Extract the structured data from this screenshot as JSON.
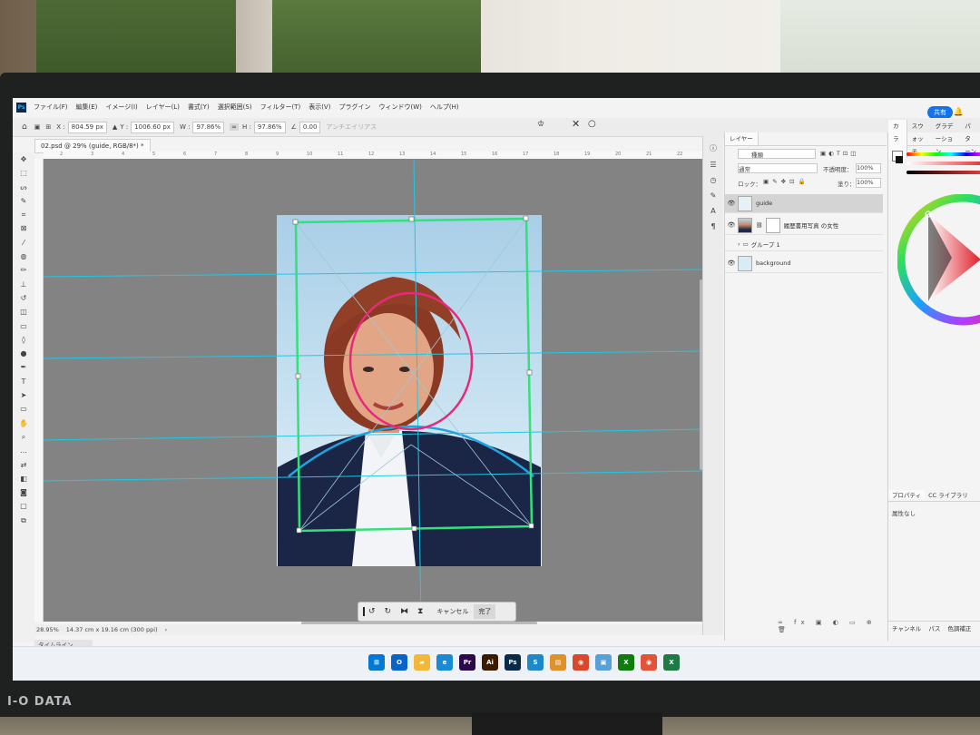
{
  "app": {
    "logo": "Ps",
    "menu": [
      "ファイル(F)",
      "編集(E)",
      "イメージ(I)",
      "レイヤー(L)",
      "書式(Y)",
      "選択範囲(S)",
      "フィルター(T)",
      "表示(V)",
      "プラグイン",
      "ウィンドウ(W)",
      "ヘルプ(H)"
    ],
    "share_label": "共有"
  },
  "options": {
    "x_label": "X :",
    "x_value": "804.59 px",
    "y_label": "Y :",
    "y_value": "1006.60 px",
    "w_label": "W :",
    "w_value": "97.86%",
    "h_label": "H :",
    "h_value": "97.86%",
    "angle_value": "0.00",
    "antialias_label": "アンチエイリアス"
  },
  "document": {
    "tab_title": "02.psd @ 29% (guide, RGB/8*) *",
    "zoom": "28.95%",
    "size_info": "14.37 cm x 19.16 cm (300 ppi)",
    "timeline_label": "タイムライン"
  },
  "ruler": {
    "ticks": [
      "2",
      "3",
      "4",
      "5",
      "6",
      "7",
      "8",
      "9",
      "10",
      "11",
      "12",
      "13",
      "14",
      "15",
      "16",
      "17",
      "18",
      "19",
      "20",
      "21",
      "22"
    ]
  },
  "context_bar": {
    "cancel_label": "キャンセル",
    "done_label": "完了"
  },
  "layers_panel": {
    "tab_label": "レイヤー",
    "kind_label": "種類",
    "blend_mode": "通常",
    "opacity_label": "不透明度：",
    "opacity_value": "100%",
    "lock_label": "ロック：",
    "fill_label": "塗り：",
    "fill_value": "100%",
    "layers": [
      {
        "name": "guide",
        "visible": true,
        "selected": true
      },
      {
        "name": "履歴書用写真 の女性",
        "visible": true,
        "selected": false
      },
      {
        "name": "グループ 1",
        "visible": false,
        "selected": false
      },
      {
        "name": "background",
        "visible": true,
        "selected": false
      }
    ],
    "footer_icons": "∞ fx ▣ ◐ ▭ ⊕ 🗑"
  },
  "color_panel": {
    "tabs": [
      "カラー",
      "スウォッチ",
      "グラデーション",
      "パターン"
    ],
    "properties_tabs": [
      "プロパティ",
      "CC ライブラリ"
    ],
    "properties_none": "属性なし",
    "bottom_tabs": [
      "チャンネル",
      "パス",
      "色調補正"
    ]
  },
  "taskbar": {
    "icons": [
      {
        "name": "windows-start",
        "glyph": "⊞",
        "color": "#0078d4"
      },
      {
        "name": "outlook",
        "glyph": "O",
        "color": "#0a64c8"
      },
      {
        "name": "file-explorer",
        "glyph": "▰",
        "color": "#f2b83a"
      },
      {
        "name": "edge",
        "glyph": "e",
        "color": "#1a8ad4"
      },
      {
        "name": "premiere",
        "glyph": "Pr",
        "color": "#2a0a4a"
      },
      {
        "name": "illustrator",
        "glyph": "Ai",
        "color": "#3a1a00"
      },
      {
        "name": "photoshop",
        "glyph": "Ps",
        "color": "#0a2a4a"
      },
      {
        "name": "app-s",
        "glyph": "S",
        "color": "#1e88c8"
      },
      {
        "name": "app-orange",
        "glyph": "▤",
        "color": "#e0922a"
      },
      {
        "name": "chrome",
        "glyph": "◉",
        "color": "#d9482b"
      },
      {
        "name": "store",
        "glyph": "▣",
        "color": "#5aa0d8"
      },
      {
        "name": "xbox",
        "glyph": "X",
        "color": "#107c10"
      },
      {
        "name": "chrome-2",
        "glyph": "◉",
        "color": "#e2543a"
      },
      {
        "name": "excel",
        "glyph": "X",
        "color": "#1d7a45"
      }
    ]
  },
  "monitor_brand": "I-O DATA",
  "colors": {
    "guide_cyan": "#1ec8e6",
    "transform_green": "#33e07a",
    "face_magenta": "#e8297a",
    "shoulder_blue": "#1ea5e0",
    "accent_blue": "#1473e6"
  }
}
